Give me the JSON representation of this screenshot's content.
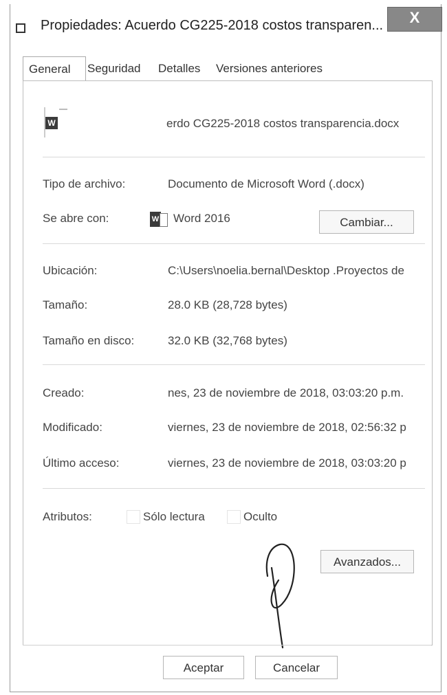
{
  "window": {
    "title": "Propiedades: Acuerdo CG225-2018 costos transparen...",
    "close_label": "X"
  },
  "tabs": [
    "General",
    "Seguridad",
    "Detalles",
    "Versiones anteriores"
  ],
  "file": {
    "name": "erdo CG225-2018 costos transparencia.docx",
    "icon_letter": "W"
  },
  "props": {
    "tipo_label": "Tipo de archivo:",
    "tipo_value": "Documento de Microsoft Word (.docx)",
    "abre_label": "Se abre con:",
    "abre_value": "Word 2016",
    "cambiar_label": "Cambiar...",
    "ubicacion_label": "Ubicación:",
    "ubicacion_value": "C:\\Users\\noelia.bernal\\Desktop .Proyectos de",
    "tamano_label": "Tamaño:",
    "tamano_value": "28.0 KB (28,728 bytes)",
    "tamano_disco_label": "Tamaño en disco:",
    "tamano_disco_value": "32.0 KB (32,768 bytes)",
    "creado_label": "Creado:",
    "creado_value": "nes, 23 de noviembre de 2018, 03:03:20 p.m.",
    "modificado_label": "Modificado:",
    "modificado_value": "viernes, 23 de noviembre de 2018, 02:56:32 p",
    "acceso_label": "Último acceso:",
    "acceso_value": "viernes, 23 de noviembre de 2018, 03:03:20 p",
    "atributos_label": "Atributos:",
    "solo_lectura_label": "Sólo lectura",
    "oculto_label": "Oculto",
    "avanzados_label": "Avanzados..."
  },
  "buttons": {
    "aceptar": "Aceptar",
    "cancelar": "Cancelar"
  }
}
